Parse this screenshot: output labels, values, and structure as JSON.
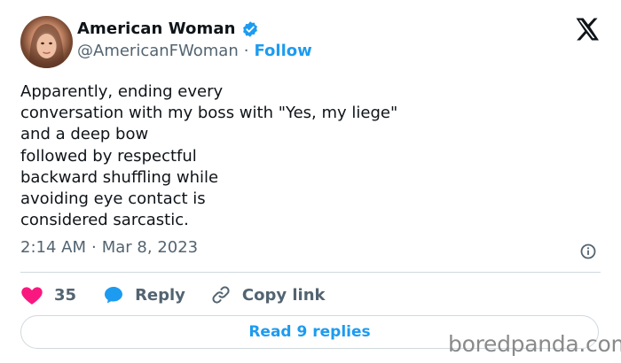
{
  "author": {
    "name": "American Woman",
    "handle": "@AmericanFWoman",
    "separator": "·",
    "follow_label": "Follow"
  },
  "tweet": {
    "lines": [
      "Apparently, ending every",
      "conversation with my boss with \"Yes, my liege\"",
      "and a deep bow",
      "followed by respectful",
      "backward shuffling while",
      "avoiding eye contact is",
      "considered sarcastic."
    ],
    "time": "2:14 AM",
    "date": "Mar 8, 2023",
    "separator": "·"
  },
  "actions": {
    "like_count": "35",
    "reply_label": "Reply",
    "copy_link_label": "Copy link",
    "read_replies_label": "Read 9 replies"
  },
  "icons": {
    "verified": "verified-badge-icon",
    "platform": "x-logo-icon",
    "info": "info-icon",
    "like": "heart-icon",
    "reply": "speech-bubble-icon",
    "link": "link-icon"
  },
  "colors": {
    "accent": "#1d9bf0",
    "like": "#f91880",
    "secondary_text": "#536471"
  },
  "watermark": "boredpanda.com"
}
